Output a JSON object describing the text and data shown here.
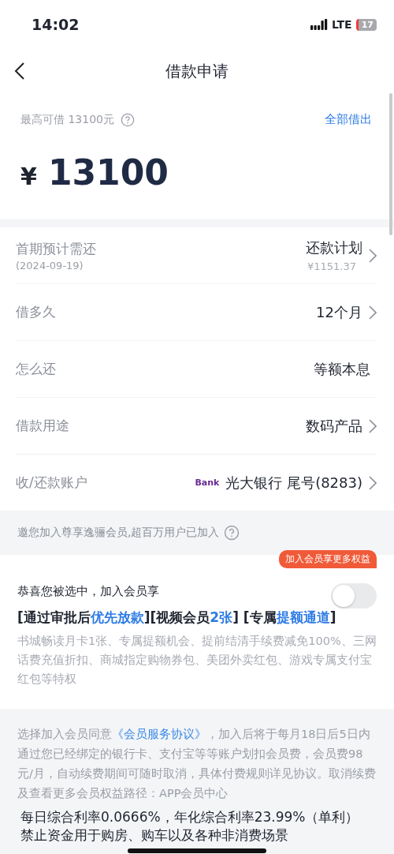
{
  "status_bar": {
    "time": "14:02",
    "network": "LTE",
    "battery": "17"
  },
  "nav": {
    "title": "借款申请"
  },
  "amount_card": {
    "limit_label": "最高可借 13100元",
    "borrow_all": "全部借出",
    "currency": "¥",
    "amount": "13100"
  },
  "rows": [
    {
      "label": "首期预计需还",
      "sublabel": "(2024-09-19)",
      "value": "还款计划",
      "subvalue": "¥1151.37",
      "chevron": true
    },
    {
      "label": "借多久",
      "value": "12个月",
      "chevron": true
    },
    {
      "label": "怎么还",
      "value": "等额本息",
      "chevron": false
    },
    {
      "label": "借款用途",
      "value": "数码产品",
      "chevron": true
    },
    {
      "label": "收/还款账户",
      "logo": "Bank",
      "value": "光大银行 尾号(8283)",
      "chevron": true
    }
  ],
  "invite": {
    "text": "邀您加入尊享逸骊会员,超百万用户已加入"
  },
  "member": {
    "badge": "加入会员享更多权益",
    "title": "恭喜您被选中，加入会员享",
    "on": false,
    "benefits": [
      {
        "text": "[通过审批后",
        "highlight": false
      },
      {
        "text": "优先放款",
        "highlight": true
      },
      {
        "text": "][视频会员",
        "highlight": false
      },
      {
        "text": "2张",
        "highlight": true
      },
      {
        "text": "] [专属",
        "highlight": false
      },
      {
        "text": "提额通道",
        "highlight": true
      },
      {
        "text": "]",
        "highlight": false
      }
    ],
    "description": "书城畅读月卡1张、专属提额机会、提前结清手续费减免100%、三网话费充值折扣、商城指定购物券包、美团外卖红包、游戏专属支付宝红包等特权"
  },
  "agreement": {
    "before": "选择加入会员同意",
    "link": "《会员服务协议》",
    "after": "，加入后将于每月18日后5日内通过您已经绑定的银行卡、支付宝等等账户划扣会员费，会员费98元/月，自动续费期间可随时取消，具体付费规则详见协议。取消续费及查看更多会员权益路径：APP会员中心"
  },
  "rates": [
    "每日综合利率0.0666%，年化综合利率23.99%（单利）",
    "禁止资金用于购房、购车以及各种非消费场景"
  ]
}
